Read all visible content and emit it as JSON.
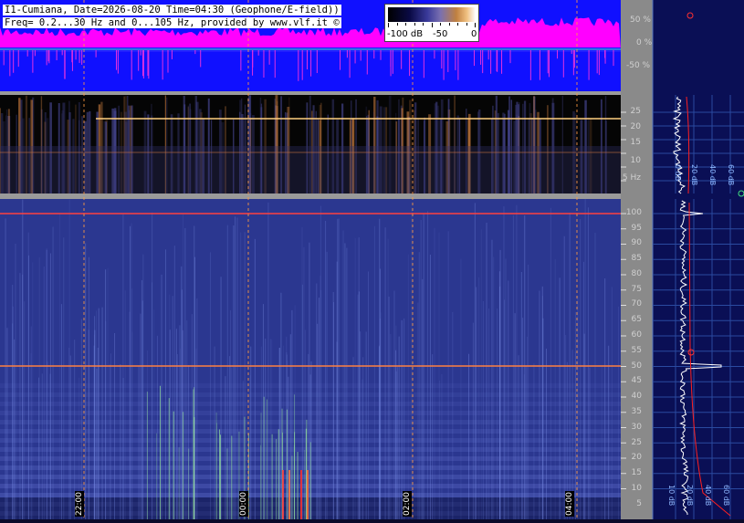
{
  "header": {
    "line1": "I1-Cumiana, Date=2026-08-20 Time=04:30 (Geophone/E-field))",
    "line2": "Freq= 0.2...30 Hz and 0...105 Hz, provided by www.vlf.it ©"
  },
  "colorbar": {
    "labels": [
      "-100 dB",
      "-50",
      "0"
    ]
  },
  "top_axis": {
    "labels": [
      "50 %",
      "0 %",
      "-50 %"
    ]
  },
  "low_freq_axis": {
    "labels": [
      "25",
      "20",
      "15",
      "10",
      "5 Hz"
    ]
  },
  "high_freq_axis": {
    "labels": [
      "100",
      "95",
      "90",
      "85",
      "80",
      "75",
      "70",
      "65",
      "60",
      "55",
      "50",
      "45",
      "40",
      "35",
      "30",
      "25",
      "20",
      "15",
      "10",
      "5"
    ]
  },
  "spectrum_db_labels_top": [
    "0 dB",
    "20 dB",
    "40 dB",
    "60 dB"
  ],
  "spectrum_db_labels_bottom": [
    "10 dB",
    "20 dB",
    "40 dB",
    "60 dB",
    "80 dB"
  ],
  "time_labels": [
    "22:00",
    "00:00",
    "02:00",
    "04:00"
  ],
  "colors": {
    "top_blue": "#1010ff",
    "top_magenta": "#ff00ff",
    "grid_orange": "#ff9a40",
    "spectrum_line": "#ffffff",
    "fit_line": "#ff2020"
  }
}
